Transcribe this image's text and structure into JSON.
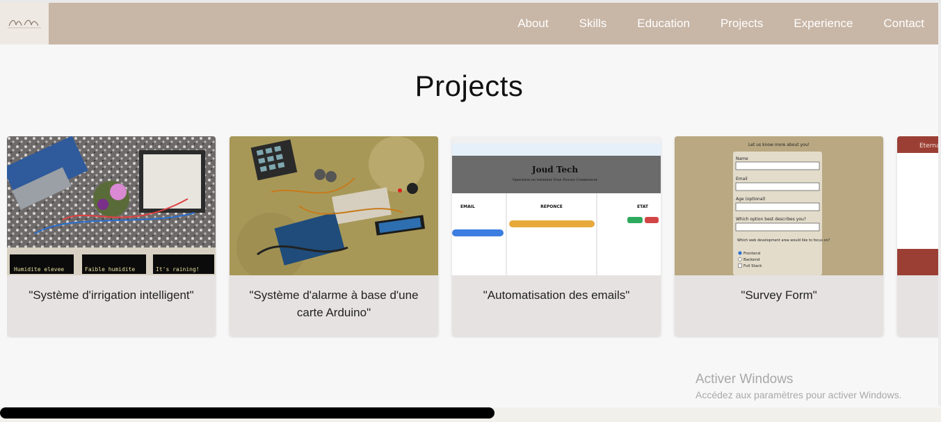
{
  "nav": {
    "items": [
      {
        "label": "About"
      },
      {
        "label": "Skills"
      },
      {
        "label": "Education"
      },
      {
        "label": "Projects"
      },
      {
        "label": "Experience"
      },
      {
        "label": "Contact"
      }
    ]
  },
  "section": {
    "title": "Projects"
  },
  "projects": [
    {
      "caption": "\"Système d'irrigation intelligent\"",
      "displays": [
        "Humidite elevee",
        "Faible humidite",
        "It's raining!"
      ]
    },
    {
      "caption": "\"Système d'alarme à base d'une carte Arduino\""
    },
    {
      "caption": "\"Automatisation des emails\"",
      "screen": {
        "title": "Joud Tech",
        "subtitle": "Operation en terminer Vous Pouvez Commencer",
        "columns": [
          "EMAIL",
          "REPONCE",
          "ETAT"
        ]
      }
    },
    {
      "caption": "\"Survey Form\"",
      "form": {
        "heading": "Let us know more about you!",
        "fields": [
          "Name",
          "Email",
          "Age (optional)",
          "Which option best describes you?",
          "Which web development area would like to focus on?"
        ],
        "options": [
          "Frontend",
          "Backend",
          "Full Stack"
        ]
      }
    },
    {
      "caption": "",
      "partial_heading": "Eterna"
    }
  ],
  "windows_watermark": {
    "title": "Activer Windows",
    "subtitle": "Accédez aux paramètres pour activer Windows."
  },
  "colors": {
    "navbar": "#c8b6a6",
    "card": "#e6e2e1",
    "page": "#f7f7f7"
  }
}
